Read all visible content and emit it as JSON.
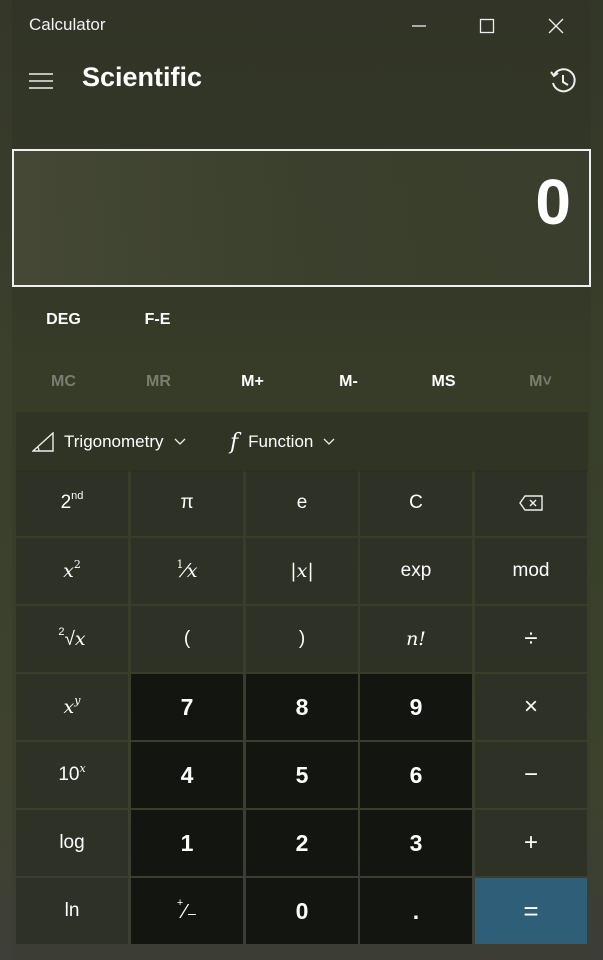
{
  "window": {
    "title": "Calculator",
    "controls": {
      "minimize": "minimize-icon",
      "maximize": "maximize-icon",
      "close": "close-icon"
    }
  },
  "header": {
    "mode_title": "Scientific",
    "menu_icon": "hamburger-icon",
    "history_icon": "history-icon"
  },
  "display": {
    "value": "0"
  },
  "modes": {
    "angle": "DEG",
    "fe": "F-E"
  },
  "memory": {
    "buttons": [
      {
        "label": "MC",
        "enabled": false
      },
      {
        "label": "MR",
        "enabled": false
      },
      {
        "label": "M+",
        "enabled": true
      },
      {
        "label": "M-",
        "enabled": true
      },
      {
        "label": "MS",
        "enabled": true
      },
      {
        "label": "M˅",
        "enabled": false
      }
    ]
  },
  "funcbar": {
    "trig_label": "Trigonometry",
    "function_label": "Function",
    "function_glyph": "f"
  },
  "keys": {
    "row1": [
      "2nd",
      "π",
      "e",
      "C",
      "backspace-icon"
    ],
    "row2": [
      "x²",
      "¹⁄x",
      "|x|",
      "exp",
      "mod"
    ],
    "row3": [
      "²√x",
      "(",
      ")",
      "n!",
      "÷"
    ],
    "row4": [
      "xʸ",
      "7",
      "8",
      "9",
      "×"
    ],
    "row5": [
      "10ˣ",
      "4",
      "5",
      "6",
      "−"
    ],
    "row6": [
      "log",
      "1",
      "2",
      "3",
      "+"
    ],
    "row7": [
      "ln",
      "⁺⁄₋",
      "0",
      ".",
      "="
    ]
  },
  "colors": {
    "equals_accent": "#2f5f78",
    "display_border": "#f0f0f0"
  }
}
